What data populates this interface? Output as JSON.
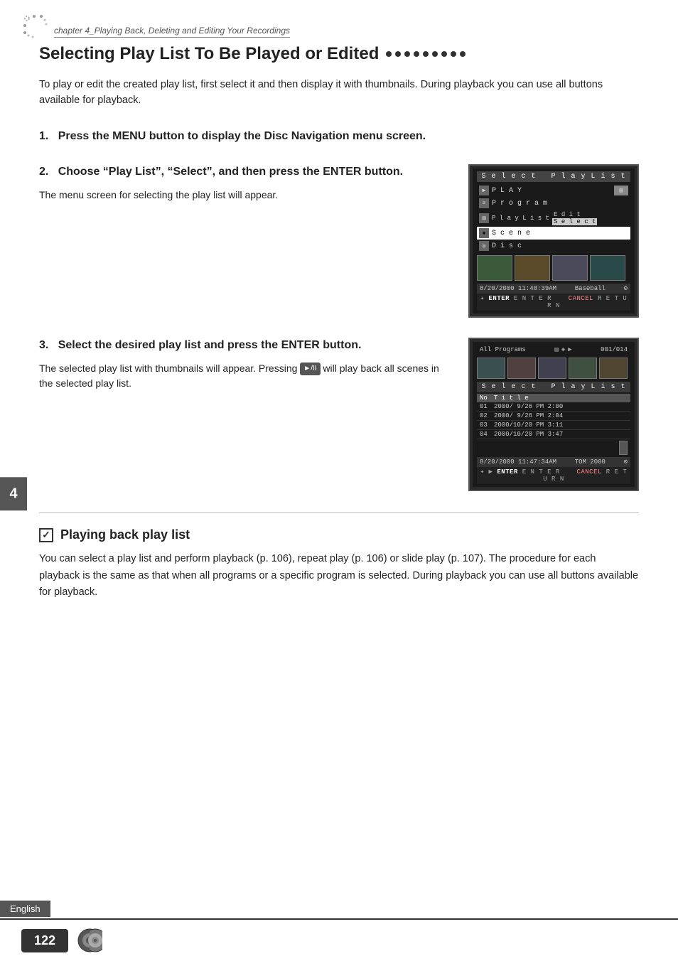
{
  "breadcrumb": {
    "text": "chapter 4_Playing Back, Deleting and Editing Your Recordings"
  },
  "page_title": "Selecting Play List To Be Played or Edited",
  "title_dots_count": 9,
  "intro": "To play or edit the created play list, first select it and then display it with thumbnails. During playback you can use all buttons available for playback.",
  "steps": [
    {
      "number": "1.",
      "heading": "Press the MENU button to display the Disc Navigation menu screen."
    },
    {
      "number": "2.",
      "heading": "Choose “Play List”, “Select”, and then press the ENTER button.",
      "body": "The menu screen for selecting the play list will appear."
    },
    {
      "number": "3.",
      "heading": "Select the desired play list and press the ENTER button.",
      "body_parts": [
        "The selected play list with thumbnails will appear. Pressing ",
        " will play back all scenes in the selected play list."
      ],
      "play_btn_label": "►/II"
    }
  ],
  "screen1": {
    "title": "Select Play List",
    "menu_items": [
      {
        "label": "PLAY",
        "icon": true
      },
      {
        "label": "Program",
        "icon": true
      },
      {
        "label": "PlayList",
        "sub": [
          "Edit",
          "Select"
        ],
        "highlighted_sub": 1
      },
      {
        "label": "Scene",
        "icon": false,
        "highlighted": true
      },
      {
        "label": "Disc",
        "icon": false
      }
    ],
    "status": "8/20/2000 11:48:39AM",
    "title_text": "Baseball",
    "nav": "ENTER ENTER   CANCEL RETURN"
  },
  "screen2": {
    "top_label": "All Programs",
    "top_right": "001/014",
    "subtitle": "Select PlayList",
    "columns": [
      "No",
      "Title"
    ],
    "rows": [
      {
        "no": "01",
        "title": "2000/ 9/26 PM 2:00",
        "highlighted": false
      },
      {
        "no": "02",
        "title": "2000/ 9/26 PM 2:04",
        "highlighted": false
      },
      {
        "no": "03",
        "title": "2000/10/20 PM 3:11",
        "highlighted": false
      },
      {
        "no": "04",
        "title": "2000/10/20 PM 3:47",
        "highlighted": false
      }
    ],
    "status": "8/20/2000 11:47:34AM",
    "title_text": "TOM 2000",
    "nav": "ENTER ENTER   CANCEL RETURN"
  },
  "chapter_number": "4",
  "playback_section": {
    "title": "Playing back play list",
    "body": "You can select a play list and perform playback (p. 106), repeat play (p. 106) or slide play (p. 107). The procedure for each playback is the same as that when all programs or a specific program is selected. During playback you can use all buttons available for playback."
  },
  "footer": {
    "page_number": "122",
    "language": "English"
  }
}
